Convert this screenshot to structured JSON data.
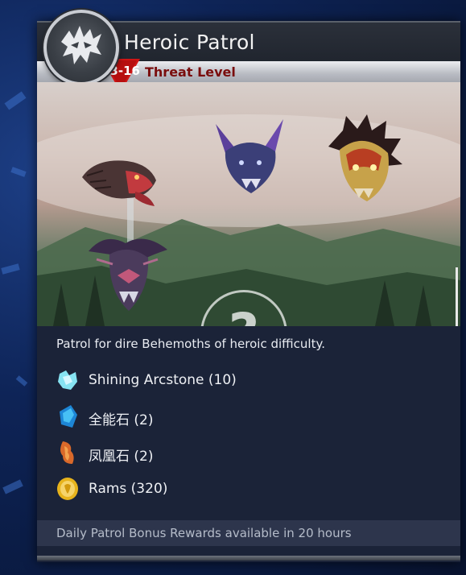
{
  "panel": {
    "title": "Heroic Patrol",
    "threat": {
      "range": "13-16",
      "label": "Threat Level"
    },
    "description": "Patrol for dire Behemoths of heroic difficulty.",
    "behemoths": [
      {
        "icon": "stone-lizard-behemoth-icon"
      },
      {
        "icon": "bat-behemoth-icon"
      },
      {
        "icon": "fire-behemoth-icon"
      },
      {
        "icon": "dark-beast-behemoth-icon"
      }
    ],
    "unknown_marker": "?",
    "rewards": [
      {
        "icon": "arcstone-icon",
        "label": "Shining Arcstone (10)"
      },
      {
        "icon": "blue-gem-icon",
        "label": "全能石 (2)"
      },
      {
        "icon": "phoenix-stone-icon",
        "label": "凤凰石 (2)"
      },
      {
        "icon": "ram-coin-icon",
        "label": "Rams (320)"
      }
    ],
    "footer": "Daily Patrol Bonus Rewards available in 20 hours"
  },
  "colors": {
    "threat_red": "#d01515",
    "threat_text": "#7a0d0d",
    "panel_bg": "#1b2338",
    "background_blue": "#0e2457"
  }
}
